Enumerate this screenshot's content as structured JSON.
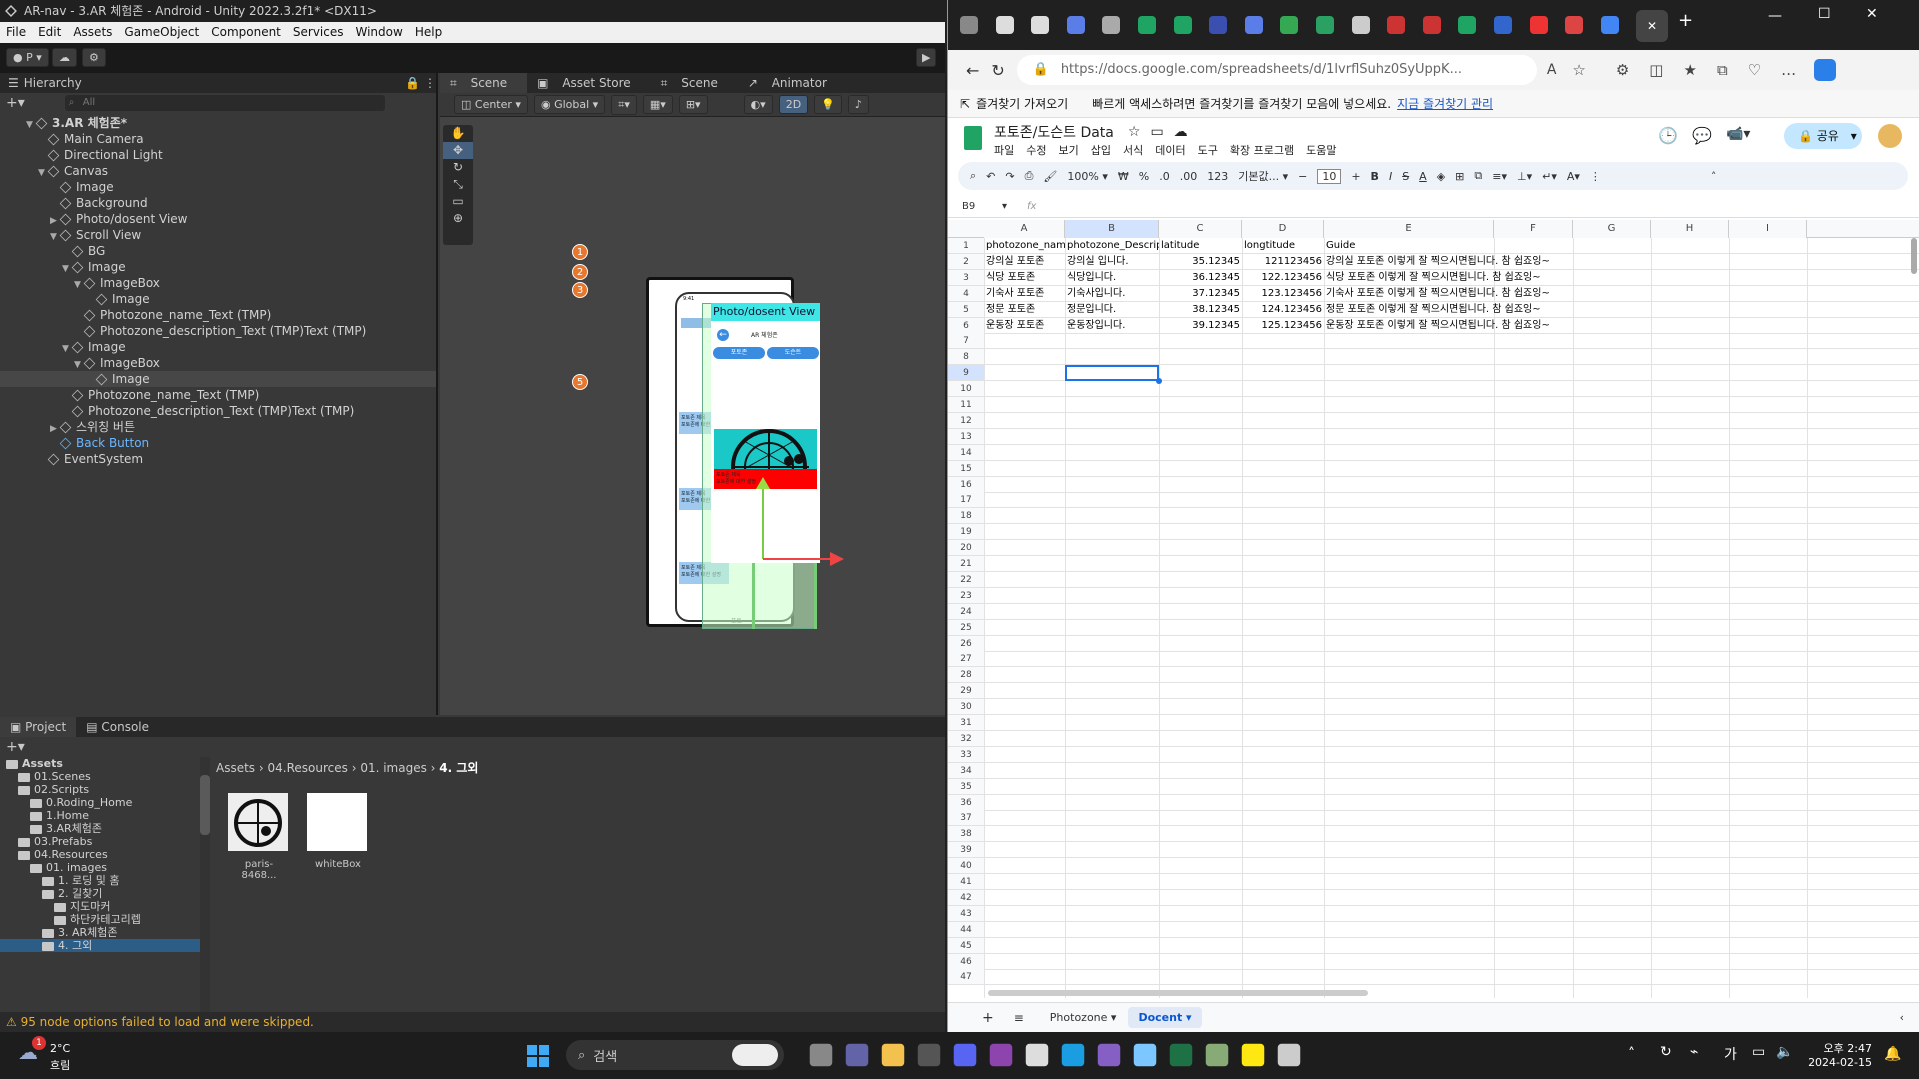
{
  "unity": {
    "title": "AR-nav - 3.AR 체험존 - Android - Unity 2022.3.2f1* <DX11>",
    "menu": [
      "File",
      "Edit",
      "Assets",
      "GameObject",
      "Component",
      "Services",
      "Window",
      "Help"
    ],
    "account": "P",
    "hierarchy": {
      "tab": "Hierarchy",
      "search_placeholder": "All",
      "nodes": [
        {
          "label": "3.AR 체험존*",
          "indent": 0,
          "expanded": true,
          "root": true
        },
        {
          "label": "Main Camera",
          "indent": 1
        },
        {
          "label": "Directional Light",
          "indent": 1
        },
        {
          "label": "Canvas",
          "indent": 1,
          "expanded": true
        },
        {
          "label": "Image",
          "indent": 2
        },
        {
          "label": "Background",
          "indent": 2
        },
        {
          "label": "Photo/dosent View",
          "indent": 2,
          "collapsed": true
        },
        {
          "label": "Scroll View",
          "indent": 2,
          "expanded": true
        },
        {
          "label": "BG",
          "indent": 3
        },
        {
          "label": "Image",
          "indent": 3,
          "expanded": true
        },
        {
          "label": "ImageBox",
          "indent": 4,
          "expanded": true
        },
        {
          "label": "Image",
          "indent": 5
        },
        {
          "label": "Photozone_name_Text (TMP)",
          "indent": 4
        },
        {
          "label": "Photozone_description_Text (TMP)Text (TMP)",
          "indent": 4
        },
        {
          "label": "Image",
          "indent": 3,
          "expanded": true
        },
        {
          "label": "ImageBox",
          "indent": 4,
          "expanded": true
        },
        {
          "label": "Image",
          "indent": 5,
          "selected": true
        },
        {
          "label": "Photozone_name_Text (TMP)",
          "indent": 3
        },
        {
          "label": "Photozone_description_Text (TMP)Text (TMP)",
          "indent": 3
        },
        {
          "label": "스위칭 버튼",
          "indent": 2,
          "collapsed": true
        },
        {
          "label": "Back Button",
          "indent": 2,
          "prefab": true
        },
        {
          "label": "EventSystem",
          "indent": 1
        }
      ]
    },
    "scene": {
      "tabs": [
        "Scene",
        "Asset Store",
        "Scene",
        "Animator"
      ],
      "pivot": "Center",
      "space": "Global",
      "mode_2d": "2D",
      "overlay_title": "Photo/dosent View",
      "phone_header": "AR 체험존",
      "btn_photozone": "포토존",
      "btn_docent": "도슨트",
      "card_title": "포토존 제목",
      "card_desc": "포토존에 대한 설명",
      "markers": [
        "1",
        "2",
        "3",
        "5"
      ],
      "phone_time": "9:41",
      "phone_tab": "포토존",
      "row_label": "포토"
    },
    "project": {
      "tabs": [
        "Project",
        "Console"
      ],
      "tree": [
        {
          "label": "Assets",
          "indent": 0,
          "bold": true
        },
        {
          "label": "01.Scenes",
          "indent": 1
        },
        {
          "label": "02.Scripts",
          "indent": 1
        },
        {
          "label": "0.Roding_Home",
          "indent": 2
        },
        {
          "label": "1.Home",
          "indent": 2
        },
        {
          "label": "3.AR체험존",
          "indent": 2
        },
        {
          "label": "03.Prefabs",
          "indent": 1
        },
        {
          "label": "04.Resources",
          "indent": 1
        },
        {
          "label": "01. images",
          "indent": 2
        },
        {
          "label": "1. 로딩 및 홈",
          "indent": 3
        },
        {
          "label": "2. 길찾기",
          "indent": 3
        },
        {
          "label": "지도마커",
          "indent": 4
        },
        {
          "label": "하단카테고리렙",
          "indent": 4
        },
        {
          "label": "3. AR체험존",
          "indent": 3
        },
        {
          "label": "4. 그외",
          "indent": 3,
          "selected": true
        }
      ],
      "breadcrumb": [
        "Assets",
        "04.Resources",
        "01. images",
        "4. 그외"
      ],
      "assets": [
        {
          "name": "paris-8468..."
        },
        {
          "name": "whiteBox"
        }
      ]
    },
    "status_warning": "95 node options failed to load and were skipped."
  },
  "browser": {
    "url": "https://docs.google.com/spreadsheets/d/1lvrflSuhz0SyUppK...",
    "favorites_import": "즐겨찾기 가져오기",
    "favorites_message": "빠르게 액세스하려면 즐겨찾기를 즐겨찾기 모음에 넣으세요.",
    "favorites_link": "지금 즐겨찾기 관리"
  },
  "sheets": {
    "title": "포토존/도슨트 Data",
    "menu": [
      "파일",
      "수정",
      "보기",
      "삽입",
      "서식",
      "데이터",
      "도구",
      "확장 프로그램",
      "도움말"
    ],
    "share": "공유",
    "zoom": "100%",
    "font": "기본값...",
    "font_size": "10",
    "fmt_123": "123",
    "cell_ref": "B9",
    "fx": "fx",
    "columns": [
      "A",
      "B",
      "C",
      "D",
      "E",
      "F",
      "G",
      "H",
      "I"
    ],
    "header": [
      "photozone_name",
      "photozone_Description",
      "latitude",
      "longtitude",
      "Guide"
    ],
    "rows": [
      [
        "강의실 포토존",
        "강의실 입니다.",
        "35.12345",
        "121123456",
        "강의실 포토존 이렇게 잘 찍으시면됩니다. 참 쉽죠잉~"
      ],
      [
        "식당 포토존",
        "식당입니다.",
        "36.12345",
        "122.123456",
        "식당 포토존 이렇게 잘 찍으시면됩니다. 참 쉽죠잉~"
      ],
      [
        "기숙사 포토존",
        "기숙사입니다.",
        "37.12345",
        "123.123456",
        "기숙사 포토존 이렇게 잘 찍으시면됩니다. 참 쉽죠잉~"
      ],
      [
        "정문 포토존",
        "정문입니다.",
        "38.12345",
        "124.123456",
        "정문 포토존 이렇게 잘 찍으시면됩니다. 참 쉽죠잉~"
      ],
      [
        "운동장 포토존",
        "운동장입니다.",
        "39.12345",
        "125.123456",
        "운동장 포토존 이렇게 잘 찍으시면됩니다. 참 쉽죠잉~"
      ]
    ],
    "row_count": 47,
    "sheet_tabs": [
      "Photozone",
      "Docent"
    ],
    "active_sheet": "Docent"
  },
  "taskbar": {
    "weather_temp": "2°C",
    "weather_desc": "흐림",
    "weather_badge": "1",
    "search_placeholder": "검색",
    "ime": "가",
    "time": "오후 2:47",
    "date": "2024-02-15"
  }
}
